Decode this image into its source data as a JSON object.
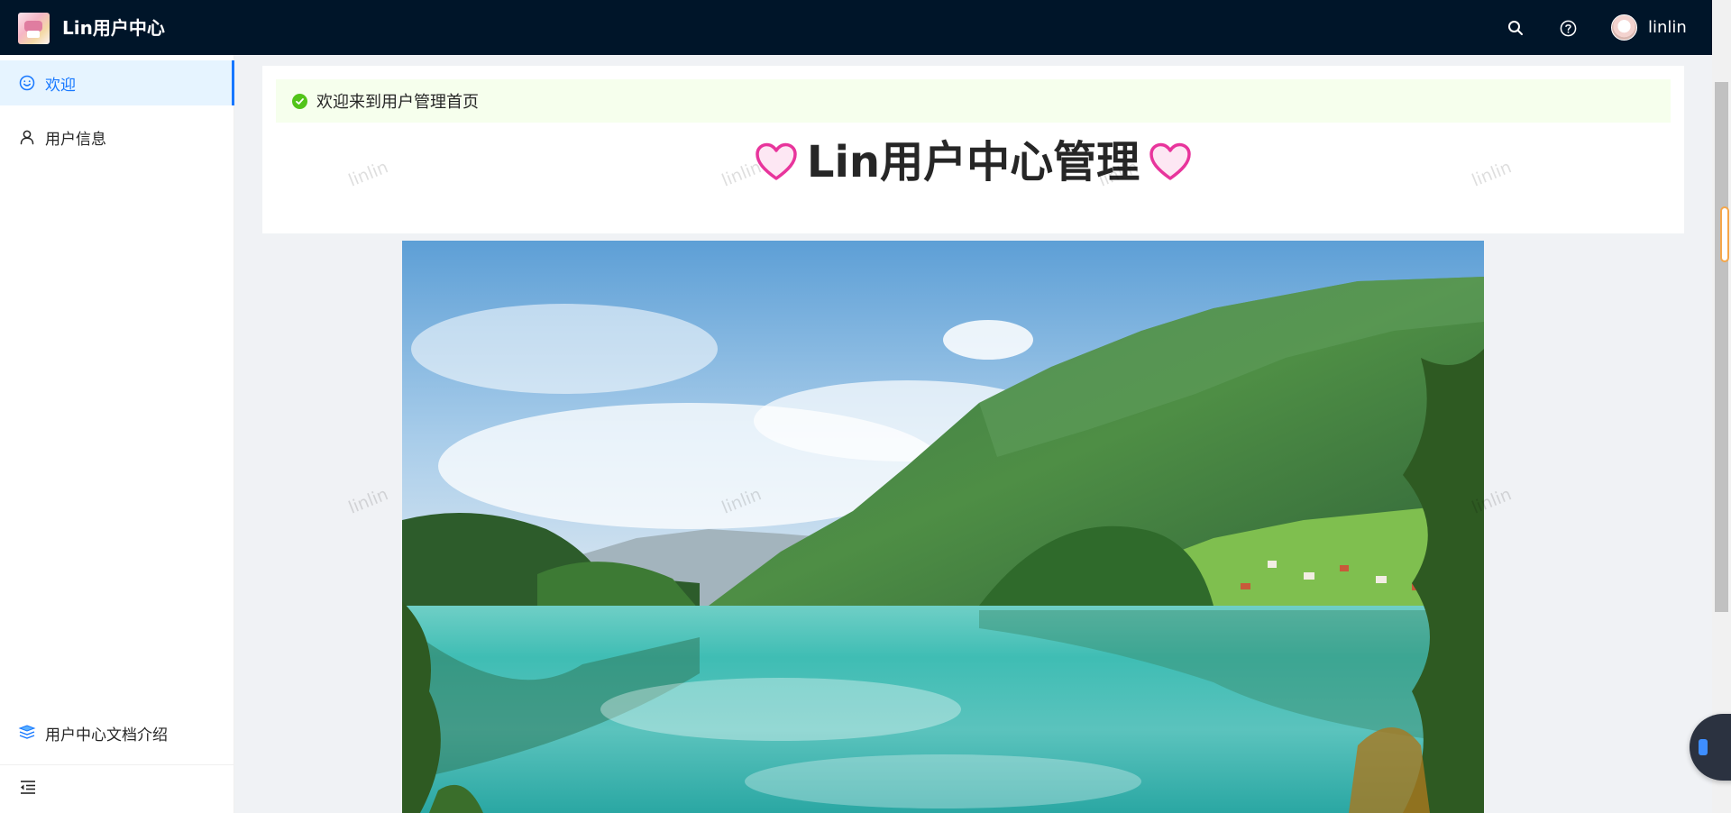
{
  "header": {
    "app_title": "Lin用户中心",
    "username": "linlin",
    "icons": [
      "search-icon",
      "question-circle-icon"
    ]
  },
  "sidebar": {
    "items": [
      {
        "label": "欢迎",
        "icon": "smile-icon",
        "active": true
      },
      {
        "label": "用户信息",
        "icon": "user-icon",
        "active": false
      }
    ],
    "doc_link": {
      "label": "用户中心文档介绍",
      "icon": "read-icon"
    },
    "collapse_icon": "menu-fold-icon"
  },
  "main": {
    "alert": "欢迎来到用户管理首页",
    "title": "Lin用户中心管理",
    "watermark": "linlin"
  },
  "colors": {
    "header_bg": "#001529",
    "accent": "#1677ff",
    "success": "#52c41a",
    "alert_bg": "#f6ffed",
    "heart": "#e8359c"
  }
}
